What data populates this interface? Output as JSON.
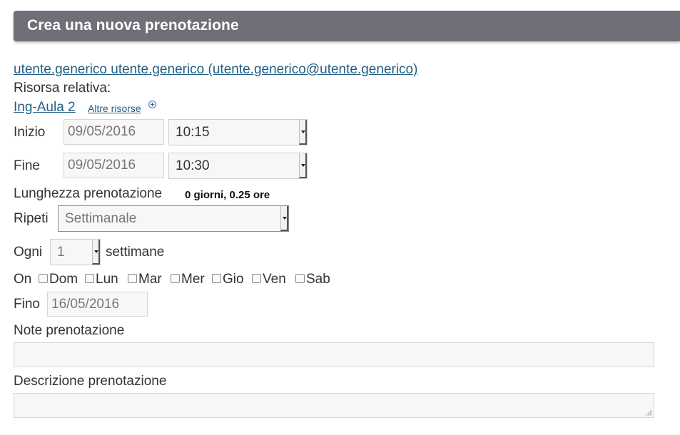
{
  "header": {
    "title": "Crea una nuova prenotazione"
  },
  "user": {
    "link": "utente.generico utente.generico (utente.generico@utente.generico)"
  },
  "resource": {
    "label": "Risorsa relativa:",
    "name": "Ing-Aula 2",
    "more_link": "Altre risorse"
  },
  "start": {
    "label": "Inizio",
    "date": "09/05/2016",
    "time": "10:15"
  },
  "end": {
    "label": "Fine",
    "date": "09/05/2016",
    "time": "10:30"
  },
  "duration": {
    "label": "Lunghezza prenotazione",
    "value": "0 giorni, 0.25 ore"
  },
  "repeat": {
    "label": "Ripeti",
    "value": "Settimanale"
  },
  "every": {
    "label": "Ogni",
    "value": "1",
    "unit": "settimane"
  },
  "on": {
    "label": "On",
    "days": [
      {
        "label": "Dom",
        "checked": false
      },
      {
        "label": "Lun",
        "checked": false
      },
      {
        "label": "Mar",
        "checked": false
      },
      {
        "label": "Mer",
        "checked": false
      },
      {
        "label": "Gio",
        "checked": false
      },
      {
        "label": "Ven",
        "checked": false
      },
      {
        "label": "Sab",
        "checked": false
      }
    ]
  },
  "until": {
    "label": "Fino",
    "date": "16/05/2016"
  },
  "notes": {
    "label": "Note prenotazione",
    "value": ""
  },
  "description": {
    "label": "Descrizione prenotazione",
    "value": ""
  },
  "icons": {
    "more_resources": "plus-circle-icon"
  },
  "colors": {
    "header_bg": "#6f6f78",
    "link": "#1f5f86"
  }
}
